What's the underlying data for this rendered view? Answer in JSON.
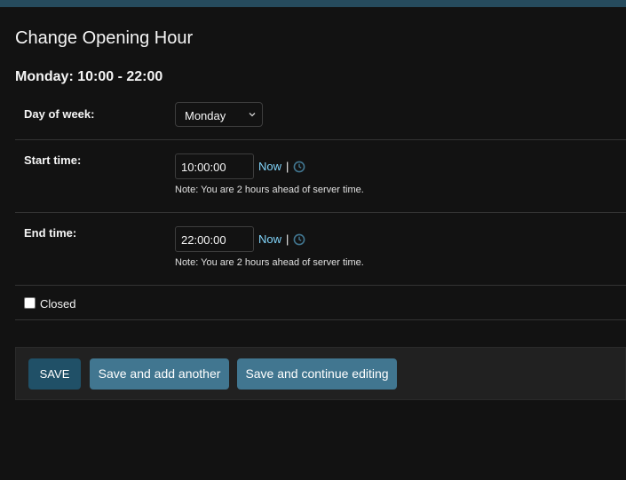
{
  "page": {
    "title": "Change Opening Hour",
    "object_title": "Monday: 10:00 - 22:00"
  },
  "form": {
    "day_of_week": {
      "label": "Day of week:",
      "selected": "Monday",
      "icon": "chevron-down-icon"
    },
    "start_time": {
      "label": "Start time:",
      "value": "10:00:00",
      "now_label": "Now",
      "separator": "|",
      "icon": "clock-icon",
      "note": "Note: You are 2 hours ahead of server time."
    },
    "end_time": {
      "label": "End time:",
      "value": "22:00:00",
      "now_label": "Now",
      "separator": "|",
      "icon": "clock-icon",
      "note": "Note: You are 2 hours ahead of server time."
    },
    "closed": {
      "label": "Closed",
      "checked": false
    }
  },
  "submit": {
    "save_label": "SAVE",
    "save_add_label": "Save and add another",
    "save_continue_label": "Save and continue editing"
  },
  "colors": {
    "background": "#121212",
    "header_bar": "#264b5d",
    "primary_button": "#205067",
    "secondary_button": "#417690",
    "link": "#81d4fa"
  }
}
